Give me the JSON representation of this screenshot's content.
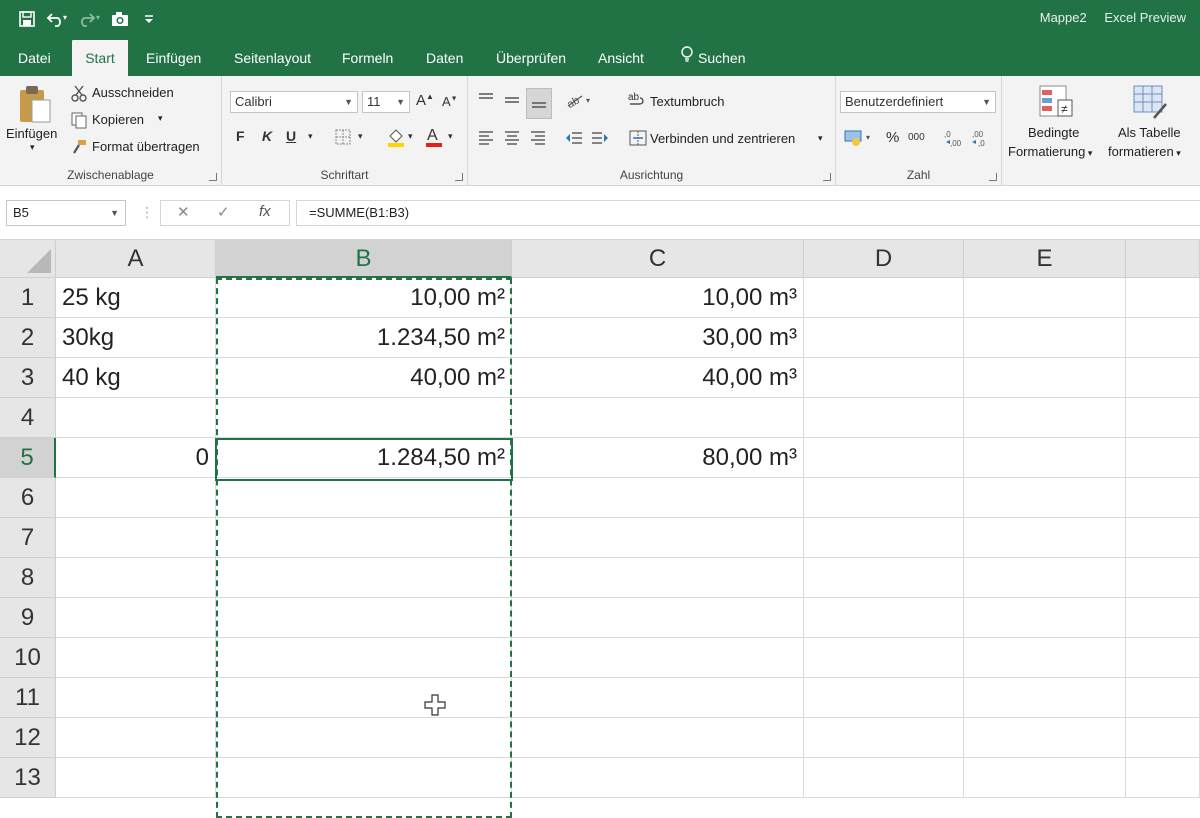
{
  "window": {
    "doc_title": "Mappe2",
    "app_title": "Excel Preview"
  },
  "qat": {
    "save_icon": "save-icon",
    "undo_icon": "undo-icon",
    "redo_icon": "redo-icon",
    "camera_icon": "camera-icon",
    "customize_icon": "customize-qat-icon"
  },
  "tabs": [
    {
      "label": "Datei"
    },
    {
      "label": "Start"
    },
    {
      "label": "Einfügen"
    },
    {
      "label": "Seitenlayout"
    },
    {
      "label": "Formeln"
    },
    {
      "label": "Daten"
    },
    {
      "label": "Überprüfen"
    },
    {
      "label": "Ansicht"
    },
    {
      "label": "Suchen"
    }
  ],
  "active_tab": "Start",
  "ribbon": {
    "clipboard": {
      "title": "Zwischenablage",
      "paste": "Einfügen",
      "cut": "Ausschneiden",
      "copy": "Kopieren",
      "format_painter": "Format übertragen"
    },
    "font": {
      "title": "Schriftart",
      "font_name": "Calibri",
      "font_size": "11",
      "grow": "A",
      "shrink": "A",
      "bold": "F",
      "italic": "K",
      "underline": "U",
      "font_color_letter": "A"
    },
    "alignment": {
      "title": "Ausrichtung",
      "wrap_text": "Textumbruch",
      "merge_center": "Verbinden und zentrieren"
    },
    "number": {
      "title": "Zahl",
      "format": "Benutzerdefiniert",
      "percent": "%",
      "thousands": "000"
    },
    "styles": {
      "conditional_line1": "Bedingte",
      "conditional_line2": "Formatierung",
      "table_line1": "Als Tabelle",
      "table_line2": "formatieren"
    }
  },
  "formula_bar": {
    "name_box": "B5",
    "cancel": "✕",
    "enter": "✓",
    "fx": "fx",
    "formula": "=SUMME(B1:B3)"
  },
  "columns": [
    "A",
    "B",
    "C",
    "D",
    "E"
  ],
  "selected_column": "B",
  "rows": [
    "1",
    "2",
    "3",
    "4",
    "5",
    "6",
    "7",
    "8",
    "9",
    "10",
    "11",
    "12",
    "13"
  ],
  "selected_row": "5",
  "cells": {
    "A1": "25 kg",
    "B1": "10,00 m²",
    "C1": "10,00 m³",
    "A2": "30kg",
    "B2": "1.234,50 m²",
    "C2": "30,00 m³",
    "A3": "40 kg",
    "B3": "40,00 m²",
    "C3": "40,00 m³",
    "A5": "0",
    "B5": "1.284,50 m²",
    "C5": "80,00 m³"
  },
  "colors": {
    "accent": "#217346"
  }
}
